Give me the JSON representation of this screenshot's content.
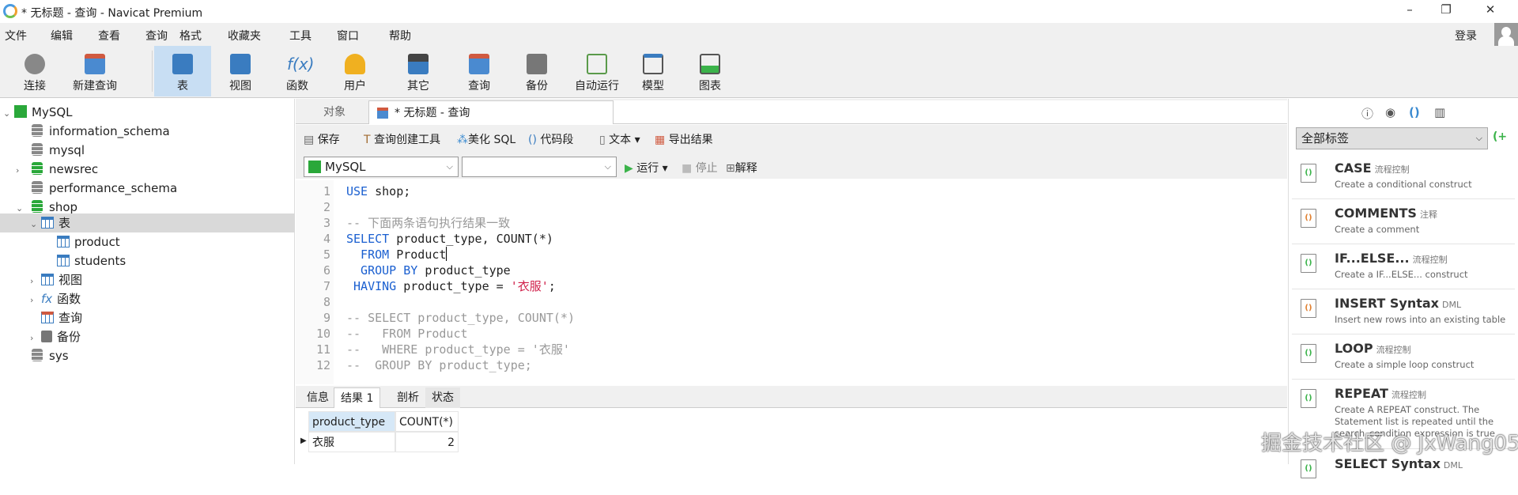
{
  "window": {
    "title": "* 无标题 - 查询 - Navicat Premium",
    "minimize": "–",
    "restore": "❐",
    "close": "✕"
  },
  "menu": [
    "文件",
    "编辑",
    "查看",
    "查询",
    "格式",
    "收藏夹",
    "工具",
    "窗口",
    "帮助"
  ],
  "login": "登录",
  "toolbar": [
    {
      "label": "连接",
      "icon": "connect-icon"
    },
    {
      "label": "新建查询",
      "icon": "new-query-icon"
    },
    {
      "label": "表",
      "icon": "table-icon"
    },
    {
      "label": "视图",
      "icon": "view-icon"
    },
    {
      "label": "函数",
      "icon": "function-icon"
    },
    {
      "label": "用户",
      "icon": "user-icon"
    },
    {
      "label": "其它",
      "icon": "tools-icon"
    },
    {
      "label": "查询",
      "icon": "query-icon"
    },
    {
      "label": "备份",
      "icon": "backup-icon"
    },
    {
      "label": "自动运行",
      "icon": "schedule-icon"
    },
    {
      "label": "模型",
      "icon": "model-icon"
    },
    {
      "label": "图表",
      "icon": "chart-icon"
    }
  ],
  "tree": {
    "root": "MySQL",
    "dbs": [
      "information_schema",
      "mysql",
      "newsrec",
      "performance_schema",
      "shop"
    ],
    "shop_children": {
      "tables": "表",
      "table_items": [
        "product",
        "students"
      ],
      "views": "视图",
      "functions": "函数",
      "queries": "查询",
      "backups": "备份"
    },
    "last": "sys"
  },
  "tabs": {
    "objects": "对象",
    "query": "* 无标题 - 查询"
  },
  "query_toolbar": {
    "save": "保存",
    "builder": "查询创建工具",
    "beautify": "美化 SQL",
    "snippet": "代码段",
    "text": "文本",
    "export": "导出结果"
  },
  "connection": "MySQL",
  "database": "",
  "run": {
    "run": "运行",
    "stop": "停止",
    "explain": "解释"
  },
  "code_lines": [
    "1",
    "2",
    "3",
    "4",
    "5",
    "6",
    "7",
    "8",
    "9",
    "10",
    "11",
    "12"
  ],
  "code": {
    "l1a": "USE",
    "l1b": " shop;",
    "l3": "-- 下面两条语句执行结果一致",
    "l4a": "SELECT",
    "l4b": " product_type, COUNT(*)",
    "l5a": "  FROM",
    "l5b": " Product",
    "l6a": "  GROUP BY",
    "l6b": " product_type",
    "l7a": " HAVING",
    "l7b": " product_type = ",
    "l7c": "'衣服'",
    "l7d": ";",
    "l9": "-- SELECT product_type, COUNT(*)",
    "l10": "--   FROM Product",
    "l11": "--   WHERE product_type = '衣服'",
    "l12": "--  GROUP BY product_type;"
  },
  "result_tabs": [
    "信息",
    "结果 1",
    "剖析",
    "状态"
  ],
  "result": {
    "columns": [
      "product_type",
      "COUNT(*)"
    ],
    "rows": [
      [
        "衣服",
        "2"
      ]
    ]
  },
  "right_panel": {
    "tag_filter": "全部标签",
    "snippets": [
      {
        "name": "CASE",
        "tag": "流程控制",
        "desc": "Create a conditional construct"
      },
      {
        "name": "COMMENTS",
        "tag": "注释",
        "desc": "Create a comment"
      },
      {
        "name": "IF...ELSE...",
        "tag": "流程控制",
        "desc": "Create a IF...ELSE... construct"
      },
      {
        "name": "INSERT Syntax",
        "tag": "DML",
        "desc": "Insert new rows into an existing table"
      },
      {
        "name": "LOOP",
        "tag": "流程控制",
        "desc": "Create a simple loop construct"
      },
      {
        "name": "REPEAT",
        "tag": "流程控制",
        "desc": "Create A REPEAT construct. The Statement list is repeated until the search_condition expression is true"
      },
      {
        "name": "SELECT Syntax",
        "tag": "DML",
        "desc": ""
      }
    ]
  },
  "watermark": "掘金技术社区 @ JxWang05"
}
